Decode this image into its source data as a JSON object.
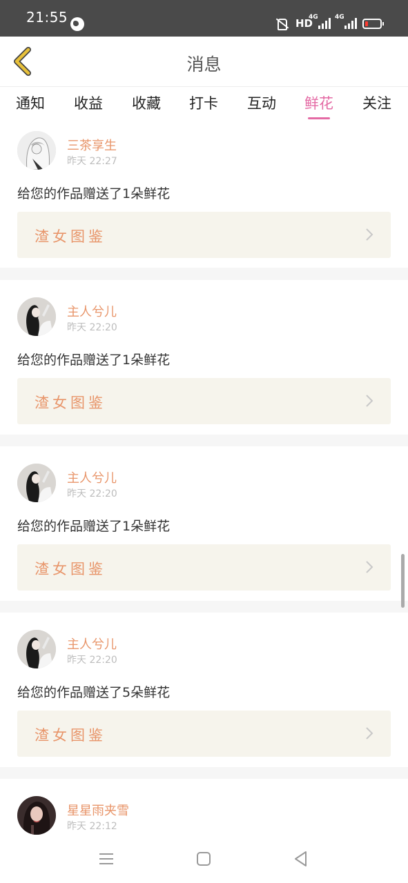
{
  "status_bar": {
    "time": "21:55",
    "hd_label": "HD",
    "network_1": "4G",
    "network_2": "4G",
    "icons": [
      "globe-icon",
      "mute-icon",
      "signal-icon",
      "battery-icon"
    ],
    "battery_color": "#ff3b30"
  },
  "header": {
    "title": "消息",
    "back_icon": "back-chevron-icon",
    "back_icon_color": "#e8c13a"
  },
  "tabs": {
    "items": [
      {
        "label": "通知"
      },
      {
        "label": "收益"
      },
      {
        "label": "收藏"
      },
      {
        "label": "打卡"
      },
      {
        "label": "互动"
      },
      {
        "label": "鲜花"
      },
      {
        "label": "关注"
      }
    ],
    "active": "鲜花",
    "active_color": "#e46aa4"
  },
  "colors": {
    "username": "#e8956a",
    "work_card_bg": "#f6f4ec",
    "timestamp": "#bdbdbd"
  },
  "messages": [
    {
      "username": "三茶享生",
      "time": "昨天 22:27",
      "text": "给您的作品赠送了1朵鲜花",
      "work_title": "渣女图鉴"
    },
    {
      "username": "主人兮儿",
      "time": "昨天 22:20",
      "text": "给您的作品赠送了1朵鲜花",
      "work_title": "渣女图鉴"
    },
    {
      "username": "主人兮儿",
      "time": "昨天 22:20",
      "text": "给您的作品赠送了1朵鲜花",
      "work_title": "渣女图鉴"
    },
    {
      "username": "主人兮儿",
      "time": "昨天 22:20",
      "text": "给您的作品赠送了5朵鲜花",
      "work_title": "渣女图鉴"
    },
    {
      "username": "星星雨夹雪",
      "time": "昨天 22:12"
    }
  ],
  "nav_bar": {
    "icons": [
      "menu-icon",
      "home-icon",
      "back-icon"
    ]
  }
}
